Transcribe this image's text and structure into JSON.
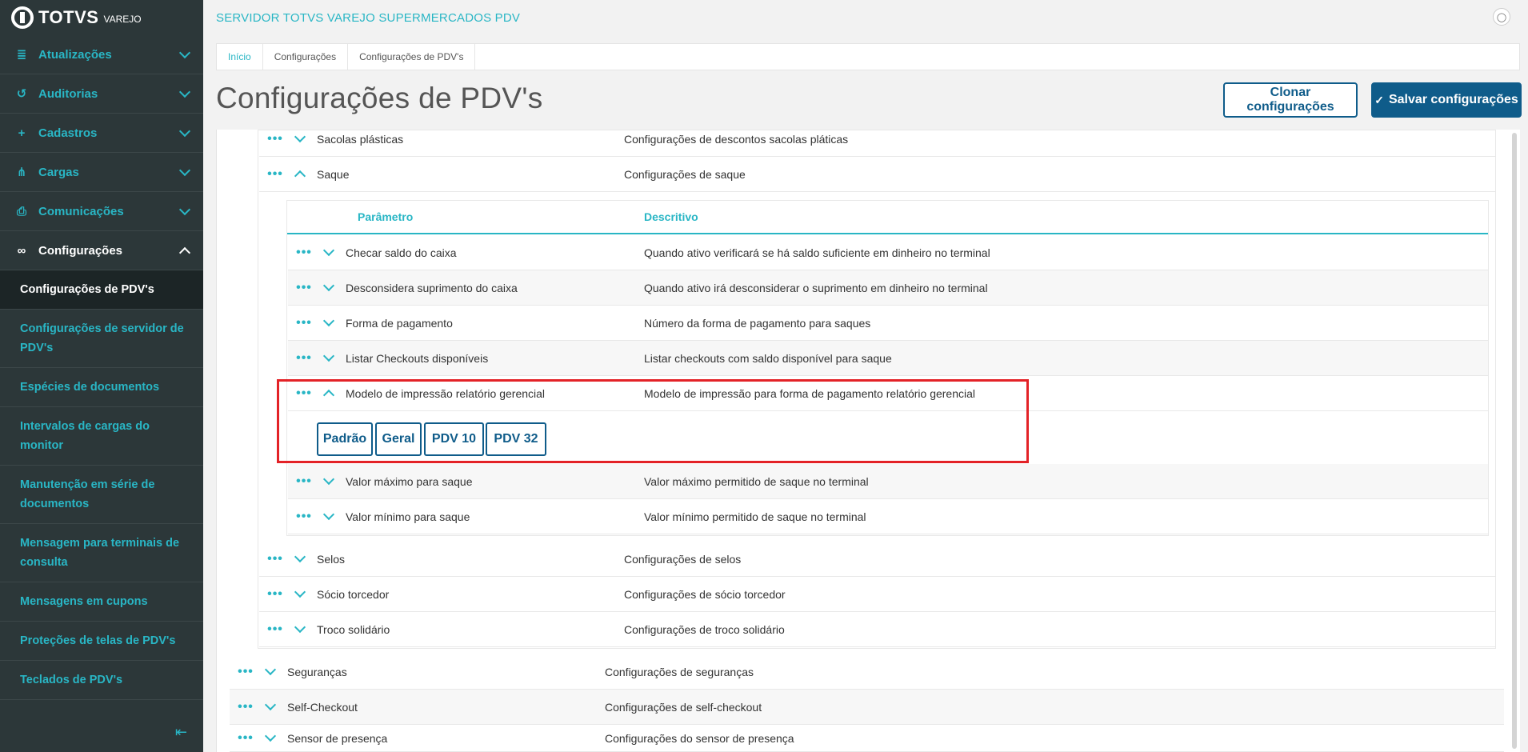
{
  "brand": {
    "name": "TOTVS",
    "sub": "VAREJO"
  },
  "sidebar": {
    "items": [
      {
        "label": "Atualizações",
        "icon": "server-icon",
        "glyph": "≣"
      },
      {
        "label": "Auditorias",
        "icon": "history-icon",
        "glyph": "↺"
      },
      {
        "label": "Cadastros",
        "icon": "add-user-icon",
        "glyph": "+"
      },
      {
        "label": "Cargas",
        "icon": "share-icon",
        "glyph": "⋔"
      },
      {
        "label": "Comunicações",
        "icon": "document-sync-icon",
        "glyph": "⎙"
      },
      {
        "label": "Configurações",
        "icon": "link-icon",
        "glyph": "∞"
      }
    ],
    "subitems": [
      "Configurações de PDV's",
      "Configurações de servidor de PDV's",
      "Espécies de documentos",
      "Intervalos de cargas do monitor",
      "Manutenção em série de documentos",
      "Mensagem para terminais de consulta",
      "Mensagens em cupons",
      "Proteções de telas de PDV's",
      "Teclados de PDV's"
    ]
  },
  "header": {
    "server_title": "SERVIDOR TOTVS VAREJO SUPERMERCADOS PDV"
  },
  "breadcrumb": [
    "Início",
    "Configurações",
    "Configurações de PDV's"
  ],
  "page": {
    "title": "Configurações de PDV's",
    "clone_label": "Clonar configurações",
    "save_label": "Salvar configurações"
  },
  "table": {
    "dots": "•••",
    "groups_top": [
      {
        "name": "Sacolas plásticas",
        "desc": "Configurações de descontos sacolas pláticas"
      },
      {
        "name": "Saque",
        "desc": "Configurações de saque"
      }
    ],
    "inner_headers": {
      "param": "Parâmetro",
      "desc": "Descritivo"
    },
    "params": [
      {
        "name": "Checar saldo do caixa",
        "desc": "Quando ativo verificará se há saldo suficiente em dinheiro no terminal"
      },
      {
        "name": "Desconsidera suprimento do caixa",
        "desc": "Quando ativo irá desconsiderar o suprimento em dinheiro no terminal"
      },
      {
        "name": "Forma de pagamento",
        "desc": "Número da forma de pagamento para saques"
      },
      {
        "name": "Listar Checkouts disponíveis",
        "desc": "Listar checkouts com saldo disponível para saque"
      },
      {
        "name": "Modelo de impressão relatório gerencial",
        "desc": "Modelo de impressão para forma de pagamento relatório gerencial"
      },
      {
        "name": "Valor máximo para saque",
        "desc": "Valor máximo permitido de saque no terminal"
      },
      {
        "name": "Valor mínimo para saque",
        "desc": "Valor mínimo permitido de saque no terminal"
      }
    ],
    "options": [
      "Padrão",
      "Geral",
      "PDV 10",
      "PDV 32"
    ],
    "groups_bottom": [
      {
        "name": "Selos",
        "desc": "Configurações de selos"
      },
      {
        "name": "Sócio torcedor",
        "desc": "Configurações de sócio torcedor"
      },
      {
        "name": "Troco solidário",
        "desc": "Configurações de troco solidário"
      }
    ],
    "sections": [
      {
        "name": "Seguranças",
        "desc": "Configurações de seguranças"
      },
      {
        "name": "Self-Checkout",
        "desc": "Configurações de self-checkout"
      },
      {
        "name": "Sensor de presença",
        "desc": "Configurações do sensor de presença"
      }
    ]
  }
}
